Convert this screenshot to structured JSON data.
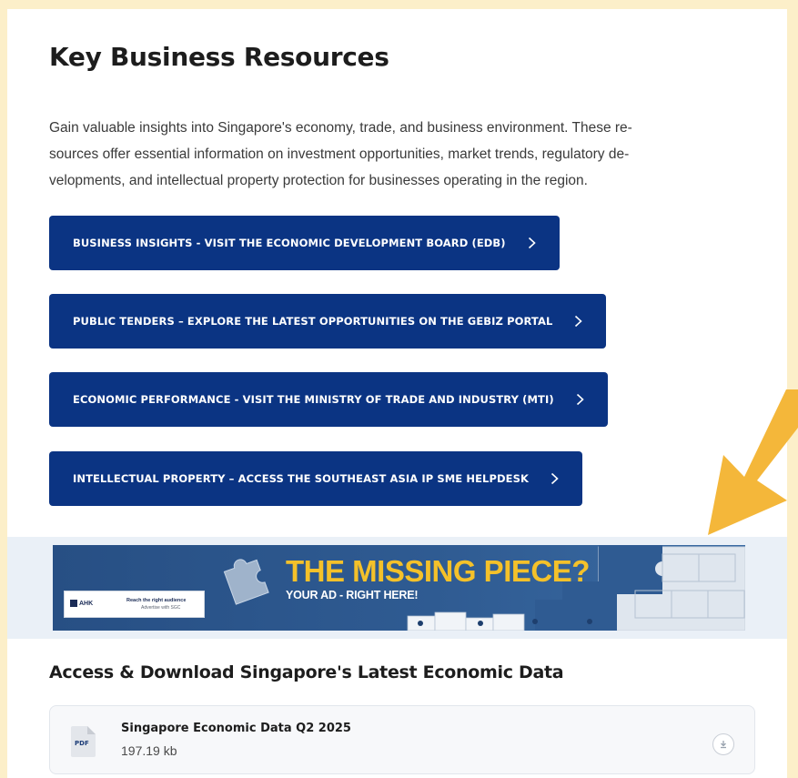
{
  "section": {
    "title": "Key Business Resources",
    "intro_lines": [
      "Gain valuable insights into Singapore's economy, trade, and business environment. These re-",
      "sources offer essential information on investment opportunities, market trends, regulatory de-",
      "velopments, and intellectual property protection for businesses operating in the region."
    ]
  },
  "resource_buttons": [
    {
      "label": "BUSINESS INSIGHTS - VISIT THE ECONOMIC DEVELOPMENT BOARD (EDB)"
    },
    {
      "label": "PUBLIC TENDERS – EXPLORE THE LATEST OPPORTUNITIES ON THE GEBIZ PORTAL"
    },
    {
      "label": "ECONOMIC PERFORMANCE - VISIT THE MINISTRY OF TRADE AND INDUSTRY (MTI)"
    },
    {
      "label": "INTELLECTUAL PROPERTY – ACCESS THE SOUTHEAST ASIA IP SME HELPDESK"
    }
  ],
  "ad_banner": {
    "headline": "THE MISSING PIECE?",
    "subline": "YOUR AD - RIGHT HERE!",
    "card_logo": "AHK",
    "card_tagline": "Reach the right audience",
    "card_subtagline": "Advertise with SGC"
  },
  "downloads": {
    "title": "Access & Download Singapore's Latest Economic Data",
    "files": [
      {
        "icon_label": "PDF",
        "name": "Singapore Economic Data Q2 2025",
        "size": "197.19 kb"
      }
    ]
  },
  "colors": {
    "button_bg": "#0b3483",
    "accent_arrow": "#f4b73a",
    "ad_headline": "#f4c12a",
    "page_background": "#fcefc9"
  },
  "icons": {
    "chevron": "chevron-right-icon",
    "download": "download-icon",
    "file": "pdf-file-icon",
    "pointer": "arrow-down-left-icon"
  }
}
